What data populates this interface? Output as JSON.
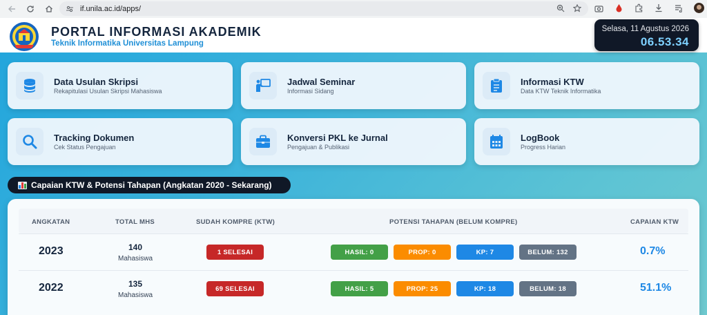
{
  "browser": {
    "url": "if.unila.ac.id/apps/"
  },
  "header": {
    "title": "PORTAL INFORMASI AKADEMIK",
    "subtitle": "Teknik Informatika Universitas Lampung"
  },
  "clock": {
    "date": "Selasa, 11 Agustus 2026",
    "time": "06.53.34"
  },
  "cards": [
    {
      "title": "Data Usulan Skripsi",
      "subtitle": "Rekapitulasi Usulan Skripsi Mahasiswa",
      "icon": "database-icon"
    },
    {
      "title": "Jadwal Seminar",
      "subtitle": "Informasi Sidang",
      "icon": "presenter-icon"
    },
    {
      "title": "Informasi KTW",
      "subtitle": "Data KTW Teknik Informatika",
      "icon": "clipboard-icon"
    },
    {
      "title": "Tracking Dokumen",
      "subtitle": "Cek Status Pengajuan",
      "icon": "search-icon"
    },
    {
      "title": "Konversi PKL ke Jurnal",
      "subtitle": "Pengajuan & Publikasi",
      "icon": "briefcase-icon"
    },
    {
      "title": "LogBook",
      "subtitle": "Progress Harian",
      "icon": "calendar-icon"
    }
  ],
  "section": {
    "title": "Capaian KTW & Potensi Tahapan (Angkatan 2020 - Sekarang)",
    "icon": "bar-chart-icon"
  },
  "table": {
    "headers": {
      "angkatan": "ANGKATAN",
      "total": "TOTAL MHS",
      "kompre": "SUDAH KOMPRE (KTW)",
      "potensi": "POTENSI TAHAPAN (BELUM KOMPRE)",
      "capaian": "CAPAIAN KTW"
    },
    "unit": "Mahasiswa",
    "rows": [
      {
        "year": "2023",
        "total": "140",
        "unit": "Mahasiswa",
        "kompre": "1 SELESAI",
        "hasil": "HASIL: 0",
        "prop": "PROP: 0",
        "kp": "KP: 7",
        "belum": "BELUM: 132",
        "capaian": "0.7%"
      },
      {
        "year": "2022",
        "total": "135",
        "unit": "Mahasiswa",
        "kompre": "69 SELESAI",
        "hasil": "HASIL: 5",
        "prop": "PROP: 25",
        "kp": "KP: 18",
        "belum": "BELUM: 18",
        "capaian": "51.1%"
      }
    ]
  },
  "colors": {
    "accent": "#1e88e5",
    "dark": "#101827",
    "red": "#c62828",
    "green": "#43a047",
    "orange": "#fb8c00",
    "gray": "#637385"
  }
}
